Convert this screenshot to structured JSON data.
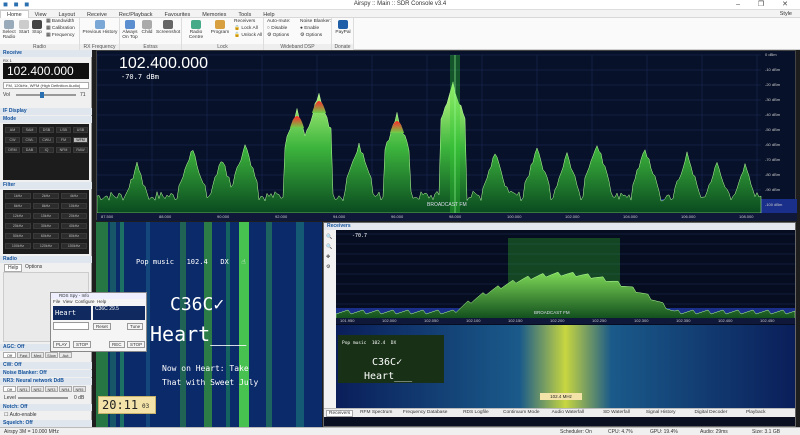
{
  "window": {
    "title": "Airspy :: Main :: SDR Console v3.4"
  },
  "menu": {
    "items": [
      "Home",
      "View",
      "Layout",
      "Receive",
      "Rec/Playback",
      "Favourites",
      "Memories",
      "Tools",
      "Help"
    ],
    "style_label": "Style"
  },
  "ribbon": {
    "groups": [
      "Radio",
      "RX Frequency",
      "Extras",
      "Lock",
      "Wideband DSP",
      "Donate"
    ],
    "select_radio": "Select Radio",
    "start": "Start",
    "stop": "Stop",
    "bandwidth": "Bandwidth",
    "calibration": "Calibration",
    "frequency": "Frequency",
    "previous_history": "Previous History",
    "always_on_top": "Always On Top",
    "child_windows": "Child",
    "screenshot": "Screenshot",
    "radio_centre": "Radio Centre",
    "program": "Program",
    "receivers": "Receivers",
    "lock_all": "Lock All",
    "unlock_all": "Unlock All",
    "auto_mute": "Auto-mute:",
    "noise_blanker": "Noise Blanker:",
    "disable": "Disable",
    "enable": "Enable",
    "options": "Options",
    "paypal": "PayPal"
  },
  "left_panel": {
    "header": "Receive",
    "rx_label": "RX 1",
    "frequency": "102.400.000",
    "mode_desc": "FM, 120kHz, WFM (High Definition Audio)",
    "volume_label": "Vol",
    "volume_value": "71",
    "sections": [
      "IF Display",
      "Mode",
      "Filter",
      "Radio",
      "AGC: Off",
      "CW: Off",
      "Noise Blanker: Off",
      "NR3: Neural network DdB",
      "Notch: Off",
      "Squelch: Off"
    ],
    "mode_buttons": [
      "AM",
      "SAM",
      "DSB",
      "LSB",
      "USB",
      "CW",
      "CWL",
      "CWU",
      "FM",
      "WFM",
      "DRM",
      "DAB",
      "IQ",
      "NFM",
      "RAW"
    ],
    "filter_buttons": [
      "1kHz",
      "2kHz",
      "4kHz",
      "6kHz",
      "8kHz",
      "10kHz",
      "12kHz",
      "15kHz",
      "20kHz",
      "25kHz",
      "30kHz",
      "40kHz",
      "50kHz",
      "60kHz",
      "80kHz",
      "100kHz",
      "120kHz",
      "150kHz"
    ],
    "radio_tabs": [
      "Help",
      "Options"
    ],
    "agc_buttons": [
      "Off",
      "Fast",
      "Med",
      "Slow",
      "Aut"
    ],
    "nr3_buttons": [
      "Off",
      "NR1",
      "NR2",
      "NR3",
      "NR4",
      "NR5"
    ],
    "level_label": "Level",
    "level_value": "0 dB",
    "auto_enable": "Auto-enable"
  },
  "spectrum": {
    "frequency": "102.400.000",
    "level": "-70.7",
    "level_unit": "dBm",
    "station_label": "BROADCAST FM",
    "db_scale": [
      "0 dBm",
      "-10 dBm",
      "-20 dBm",
      "-30 dBm",
      "-40 dBm",
      "-50 dBm",
      "-60 dBm",
      "-70 dBm",
      "-80 dBm",
      "-90 dBm",
      "-100 dBm"
    ],
    "freq_ticks": [
      "87.500",
      "88.000",
      "90.000",
      "92.000",
      "94.000",
      "96.000",
      "98.000",
      "100.000",
      "102.000",
      "104.000",
      "106.000",
      "108.000"
    ]
  },
  "waterfall": {
    "rds_line": "Pop music",
    "rds_freq": "102.4",
    "rds_mode": "DX",
    "ps_name": "C36C✓",
    "station": "Heart___",
    "radiotext": "Now on Heart: Take",
    "radiotext2": "That with Sweet July",
    "clock": "20:11",
    "clock_sec": "03"
  },
  "rds_spy": {
    "title": "RDS Spy - Info",
    "menu": [
      "File",
      "View",
      "Configure",
      "Help"
    ],
    "station": "Heart",
    "pi": "C36C",
    "ct": "29.5",
    "buttons": [
      "Reset",
      "Tune",
      "PLAY",
      "STOP",
      "REC",
      "STOP"
    ]
  },
  "receivers": {
    "title": "Receivers",
    "level": "-70.7",
    "station_label": "BROADCAST FM",
    "rds_line": "Pop music",
    "rds_freq": "102.4",
    "rds_mode": "DX",
    "ps_name": "C36C✓",
    "station": "Heart___",
    "freq_ticks": [
      "101.950",
      "102.000",
      "102.050",
      "102.100",
      "102.150",
      "102.200",
      "102.250",
      "102.300",
      "102.350",
      "102.400",
      "102.450"
    ],
    "marker": "102.4 MHz",
    "tabs": [
      "Receivers",
      "RFM Spectrum",
      "Frequency Database",
      "RDS Logfile",
      "Continuum Mode",
      "Audio Waterfall",
      "SD Waterfall",
      "Signal History",
      "Digital Decoder",
      "Playback"
    ]
  },
  "status": {
    "left": "Airspy 3M = 10.000 MHz",
    "scheduler": "Scheduler: On",
    "cpu": "CPU: 4.7%",
    "gpu": "GPU: 19.4%",
    "audio": "Audio: 29ms",
    "size": "Size: 3.1 GB"
  }
}
